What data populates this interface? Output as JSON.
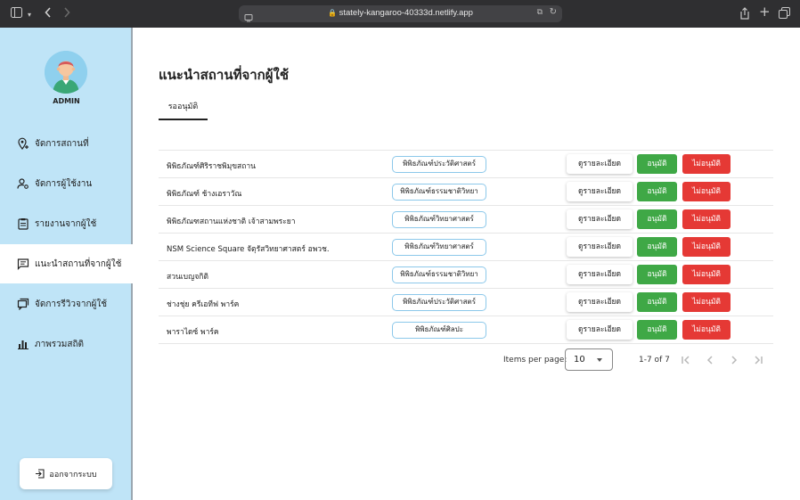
{
  "browser": {
    "url": "stately-kangaroo-40333d.netlify.app"
  },
  "sidebar": {
    "user_label": "ADMIN",
    "items": [
      {
        "label": "จัดการสถานที่",
        "icon": "location-pin-icon"
      },
      {
        "label": "จัดการผู้ใช้งาน",
        "icon": "user-settings-icon"
      },
      {
        "label": "รายงานจากผู้ใช้",
        "icon": "clipboard-icon"
      },
      {
        "label": "แนะนำสถานที่จากผู้ใช้",
        "icon": "chat-icon",
        "active": true
      },
      {
        "label": "จัดการรีวิวจากผู้ใช้",
        "icon": "reviews-icon"
      },
      {
        "label": "ภาพรวมสถิติ",
        "icon": "bar-chart-icon"
      }
    ],
    "logout_label": "ออกจากระบบ"
  },
  "main": {
    "title": "แนะนำสถานที่จากผู้ใช้",
    "tab_label": "รออนุมัติ",
    "rows": [
      {
        "name": "พิพิธภัณฑ์ศิริราชพิมุขสถาน",
        "category": "พิพิธภัณฑ์ประวัติศาสตร์"
      },
      {
        "name": "พิพิธภัณฑ์ ช้างเอราวัณ",
        "category": "พิพิธภัณฑ์ธรรมชาติวิทยา"
      },
      {
        "name": "พิพิธภัณฑสถานแห่งชาติ เจ้าสามพระยา",
        "category": "พิพิธภัณฑ์วิทยาศาสตร์"
      },
      {
        "name": "NSM Science Square จัตุรัสวิทยาศาสตร์ อพวช.",
        "category": "พิพิธภัณฑ์วิทยาศาสตร์"
      },
      {
        "name": "สวนเบญจกิติ",
        "category": "พิพิธภัณฑ์ธรรมชาติวิทยา"
      },
      {
        "name": "ช่างชุ่ย ครีเอทีฟ พาร์ค",
        "category": "พิพิธภัณฑ์ประวัติศาสตร์"
      },
      {
        "name": "พาราไดซ์ พาร์ค",
        "category": "พิพิธภัณฑ์ศิลปะ"
      }
    ],
    "actions": {
      "detail": "ดูรายละเอียด",
      "approve": "อนุมัติ",
      "reject": "ไม่อนุมัติ"
    },
    "paginator": {
      "items_per_page_label": "Items per page:",
      "page_size": "10",
      "range": "1-7 of 7"
    }
  },
  "colors": {
    "sidebar_bg": "#bfe4f7",
    "approve": "#3fa846",
    "reject": "#e53935",
    "chip_border": "#8cc8ea"
  }
}
